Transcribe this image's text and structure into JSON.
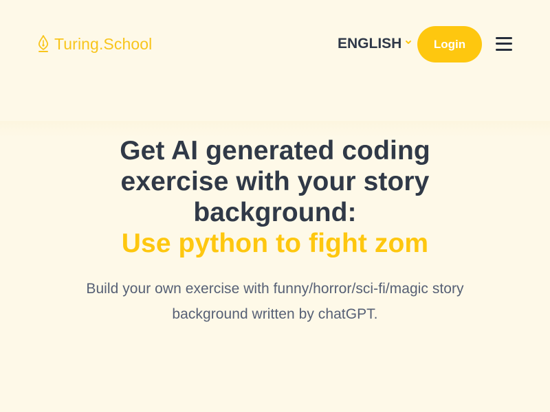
{
  "header": {
    "logo_text": "Turing.School",
    "language": "ENGLISH",
    "login": "Login",
    "icons": {
      "logo": "pen-nib-icon",
      "language": "chevron-down-icon",
      "menu": "hamburger-menu-icon"
    }
  },
  "hero": {
    "headline_lines": [
      "Get AI generated coding",
      "exercise with your story",
      "background:"
    ],
    "typed_text": "Use python to fight zom",
    "subtitle_lines": [
      "Build your own exercise with funny/horror/sci-fi/magic story",
      "background written by chatGPT."
    ]
  },
  "colors": {
    "background": "#fef9e8",
    "accent": "#fec70f",
    "heading": "#303947",
    "body_text": "#566075"
  }
}
